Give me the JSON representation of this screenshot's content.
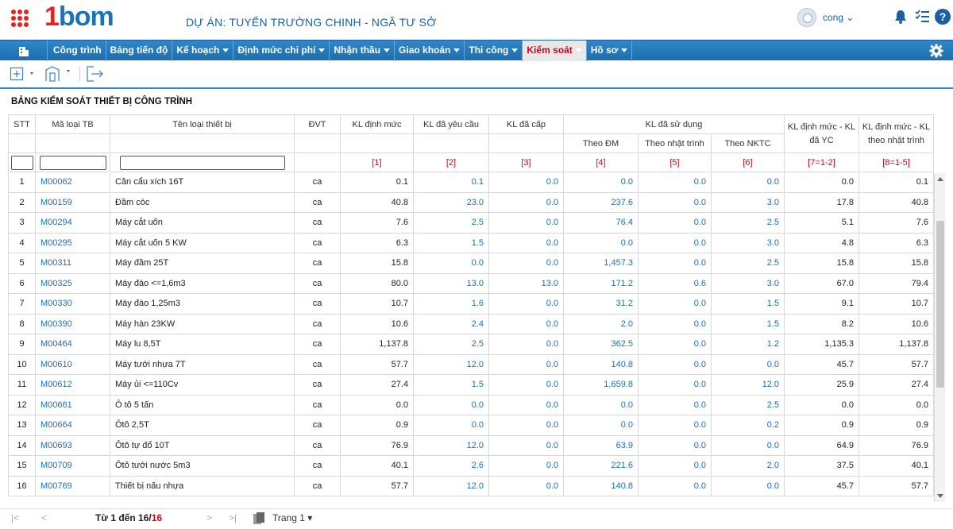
{
  "header": {
    "logo_prefix": "1",
    "logo_text": "bom",
    "project_title": "DỰ ÁN: TUYẾN TRƯỜNG CHINH - NGÃ TƯ SỞ",
    "user_name": "cong ⌄",
    "help_label": "?"
  },
  "nav": {
    "items": [
      {
        "label": "Công trình",
        "dropdown": false
      },
      {
        "label": "Bảng tiến độ",
        "dropdown": false
      },
      {
        "label": "Kế hoạch",
        "dropdown": true
      },
      {
        "label": "Định mức chi phí",
        "dropdown": true
      },
      {
        "label": "Nhận thầu",
        "dropdown": true
      },
      {
        "label": "Giao khoán",
        "dropdown": true
      },
      {
        "label": "Thi công",
        "dropdown": true
      },
      {
        "label": "Kiểm soát",
        "dropdown": true,
        "active": true
      },
      {
        "label": "Hồ sơ",
        "dropdown": true
      }
    ]
  },
  "table_title": "BẢNG KIỂM SOÁT THIẾT BỊ CÔNG TRÌNH",
  "columns": {
    "stt": "STT",
    "code": "Mã loại TB",
    "name": "Tên loại thiết bị",
    "unit": "ĐVT",
    "kl_dinh_muc": "KL định mức",
    "kl_yeu_cau": "KL đã yêu cầu",
    "kl_cap": "KL đã cấp",
    "kl_su_dung": "KL đã sử dụng",
    "theo_dm": "Theo ĐM",
    "theo_nhat_trinh": "Theo nhật trình",
    "theo_nktc": "Theo NKTC",
    "diff_yc": "KL định mức - KL đã YC",
    "diff_nt": "KL định mức - KL theo nhật trình"
  },
  "formulas": [
    "[1]",
    "[2]",
    "[3]",
    "[4]",
    "[5]",
    "[6]",
    "[7=1-2]",
    "[8=1-5]"
  ],
  "rows": [
    {
      "stt": "1",
      "code": "M00062",
      "name": "Cần cẩu xích 16T",
      "unit": "ca",
      "v": [
        "0.1",
        "0.1",
        "0.0",
        "0.0",
        "0.0",
        "0.0",
        "0.0",
        "0.1"
      ]
    },
    {
      "stt": "2",
      "code": "M00159",
      "name": "Đầm cóc",
      "unit": "ca",
      "v": [
        "40.8",
        "23.0",
        "0.0",
        "237.6",
        "0.0",
        "3.0",
        "17.8",
        "40.8"
      ]
    },
    {
      "stt": "3",
      "code": "M00294",
      "name": "Máy cắt uốn",
      "unit": "ca",
      "v": [
        "7.6",
        "2.5",
        "0.0",
        "76.4",
        "0.0",
        "2.5",
        "5.1",
        "7.6"
      ]
    },
    {
      "stt": "4",
      "code": "M00295",
      "name": "Máy cắt uốn 5 KW",
      "unit": "ca",
      "v": [
        "6.3",
        "1.5",
        "0.0",
        "0.0",
        "0.0",
        "3.0",
        "4.8",
        "6.3"
      ]
    },
    {
      "stt": "5",
      "code": "M00311",
      "name": "Máy đầm 25T",
      "unit": "ca",
      "v": [
        "15.8",
        "0.0",
        "0.0",
        "1,457.3",
        "0.0",
        "2.5",
        "15.8",
        "15.8"
      ]
    },
    {
      "stt": "6",
      "code": "M00325",
      "name": "Máy đào <=1,6m3",
      "unit": "ca",
      "v": [
        "80.0",
        "13.0",
        "13.0",
        "171.2",
        "0.6",
        "3.0",
        "67.0",
        "79.4"
      ]
    },
    {
      "stt": "7",
      "code": "M00330",
      "name": "Máy đào 1,25m3",
      "unit": "ca",
      "v": [
        "10.7",
        "1.6",
        "0.0",
        "31.2",
        "0.0",
        "1.5",
        "9.1",
        "10.7"
      ]
    },
    {
      "stt": "8",
      "code": "M00390",
      "name": "Máy hàn 23KW",
      "unit": "ca",
      "v": [
        "10.6",
        "2.4",
        "0.0",
        "2.0",
        "0.0",
        "1.5",
        "8.2",
        "10.6"
      ]
    },
    {
      "stt": "9",
      "code": "M00464",
      "name": "Máy lu 8,5T",
      "unit": "ca",
      "v": [
        "1,137.8",
        "2.5",
        "0.0",
        "362.5",
        "0.0",
        "1.2",
        "1,135.3",
        "1,137.8"
      ]
    },
    {
      "stt": "10",
      "code": "M00610",
      "name": "Máy tưới nhựa 7T",
      "unit": "ca",
      "v": [
        "57.7",
        "12.0",
        "0.0",
        "140.8",
        "0.0",
        "0.0",
        "45.7",
        "57.7"
      ]
    },
    {
      "stt": "11",
      "code": "M00612",
      "name": "Máy ủi <=110Cv",
      "unit": "ca",
      "v": [
        "27.4",
        "1.5",
        "0.0",
        "1,659.8",
        "0.0",
        "12.0",
        "25.9",
        "27.4"
      ]
    },
    {
      "stt": "12",
      "code": "M00661",
      "name": "Ô tô 5 tấn",
      "unit": "ca",
      "v": [
        "0.0",
        "0.0",
        "0.0",
        "0.0",
        "0.0",
        "2.5",
        "0.0",
        "0.0"
      ]
    },
    {
      "stt": "13",
      "code": "M00664",
      "name": "Ôtô 2,5T",
      "unit": "ca",
      "v": [
        "0.9",
        "0.0",
        "0.0",
        "0.0",
        "0.0",
        "0.2",
        "0.9",
        "0.9"
      ]
    },
    {
      "stt": "14",
      "code": "M00693",
      "name": "Ôtô tự đổ 10T",
      "unit": "ca",
      "v": [
        "76.9",
        "12.0",
        "0.0",
        "63.9",
        "0.0",
        "0.0",
        "64.9",
        "76.9"
      ]
    },
    {
      "stt": "15",
      "code": "M00709",
      "name": "Ôtô tưới nước 5m3",
      "unit": "ca",
      "v": [
        "40.1",
        "2.6",
        "0.0",
        "221.6",
        "0.0",
        "2.0",
        "37.5",
        "40.1"
      ]
    },
    {
      "stt": "16",
      "code": "M00769",
      "name": "Thiết bị nấu nhựa",
      "unit": "ca",
      "v": [
        "57.7",
        "12.0",
        "0.0",
        "140.8",
        "0.0",
        "0.0",
        "45.7",
        "57.7"
      ]
    }
  ],
  "pager": {
    "first": "|<",
    "prev": "<",
    "info_prefix": "Từ 1 đến 16/",
    "info_total": "16",
    "next": ">",
    "last": ">|",
    "page_label": "Trang 1 ▾"
  },
  "colors": {
    "brand_blue": "#1a72b8",
    "brand_red": "#e52421",
    "nav_blue": "#1e6eb0",
    "formula_red": "#d0021b"
  }
}
